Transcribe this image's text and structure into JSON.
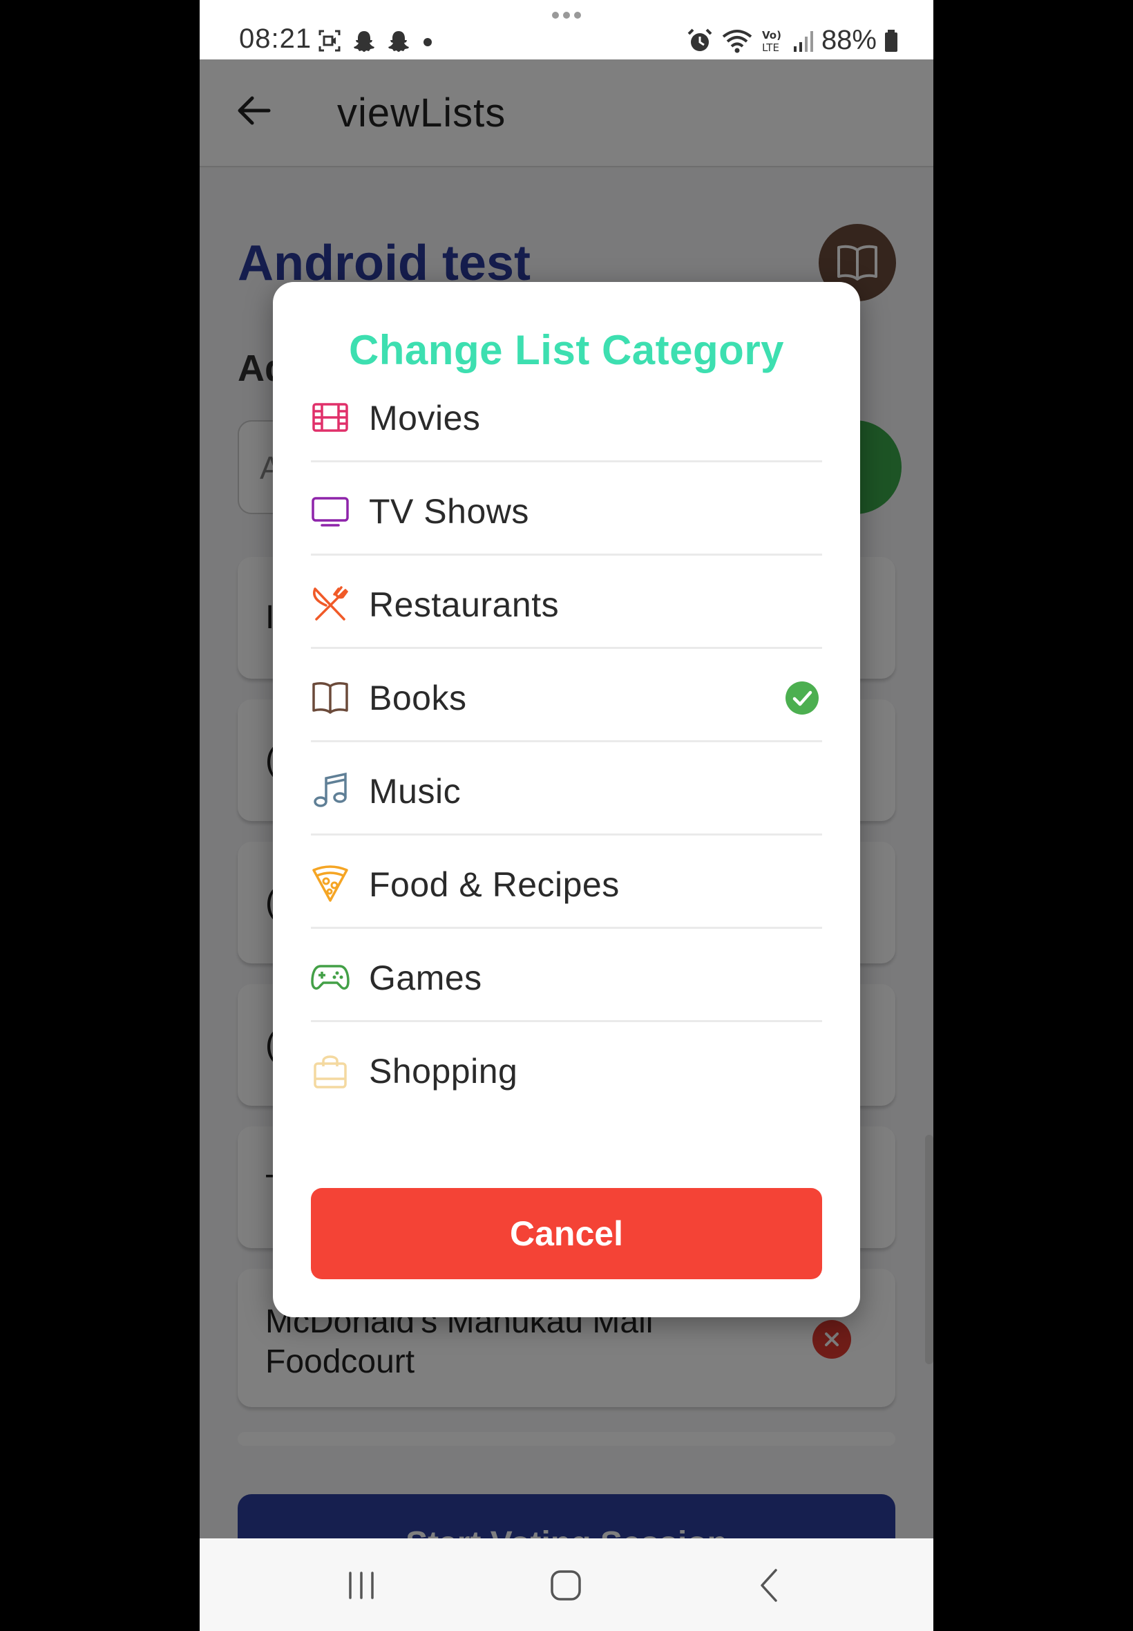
{
  "status_bar": {
    "time": "08:21",
    "battery": "88%",
    "icons_left": [
      "screen-record-icon",
      "snapchat-icon",
      "snapchat-icon",
      "dot-icon"
    ],
    "icons_right": [
      "alarm-icon",
      "wifi-icon",
      "volte-icon",
      "signal-icon",
      "battery-icon"
    ]
  },
  "app_bar": {
    "title": "viewLists"
  },
  "list": {
    "title": "Android test",
    "section_label": "Ad",
    "input_hint": "A",
    "visible_items": [
      "I",
      "(",
      "(",
      "(",
      "T"
    ],
    "last_item": "McDonald's Manukau Mall Foodcourt",
    "start_voting_label": "Start Voting Session"
  },
  "dialog": {
    "title": "Change List Category",
    "categories": [
      {
        "label": "Movies",
        "icon": "film-icon",
        "color": "#e0306a",
        "selected": false
      },
      {
        "label": "TV Shows",
        "icon": "tv-icon",
        "color": "#8e24aa",
        "selected": false
      },
      {
        "label": "Restaurants",
        "icon": "utensils-icon",
        "color": "#f05a28",
        "selected": false
      },
      {
        "label": "Books",
        "icon": "book-icon",
        "color": "#6b4a3a",
        "selected": true
      },
      {
        "label": "Music",
        "icon": "music-note-icon",
        "color": "#5f7f96",
        "selected": false
      },
      {
        "label": "Food & Recipes",
        "icon": "pizza-icon",
        "color": "#f5a524",
        "selected": false
      },
      {
        "label": "Games",
        "icon": "gamepad-icon",
        "color": "#43a047",
        "selected": false
      },
      {
        "label": "Shopping",
        "icon": "shopping-bag-icon",
        "color": "#f4d9a0",
        "selected": false
      }
    ],
    "cancel_label": "Cancel",
    "colors": {
      "title": "#3ddfb0",
      "cancel": "#f44336",
      "check": "#4caf50"
    }
  },
  "nav_bar": {
    "buttons": [
      "recent-apps-icon",
      "home-icon",
      "back-icon"
    ]
  }
}
